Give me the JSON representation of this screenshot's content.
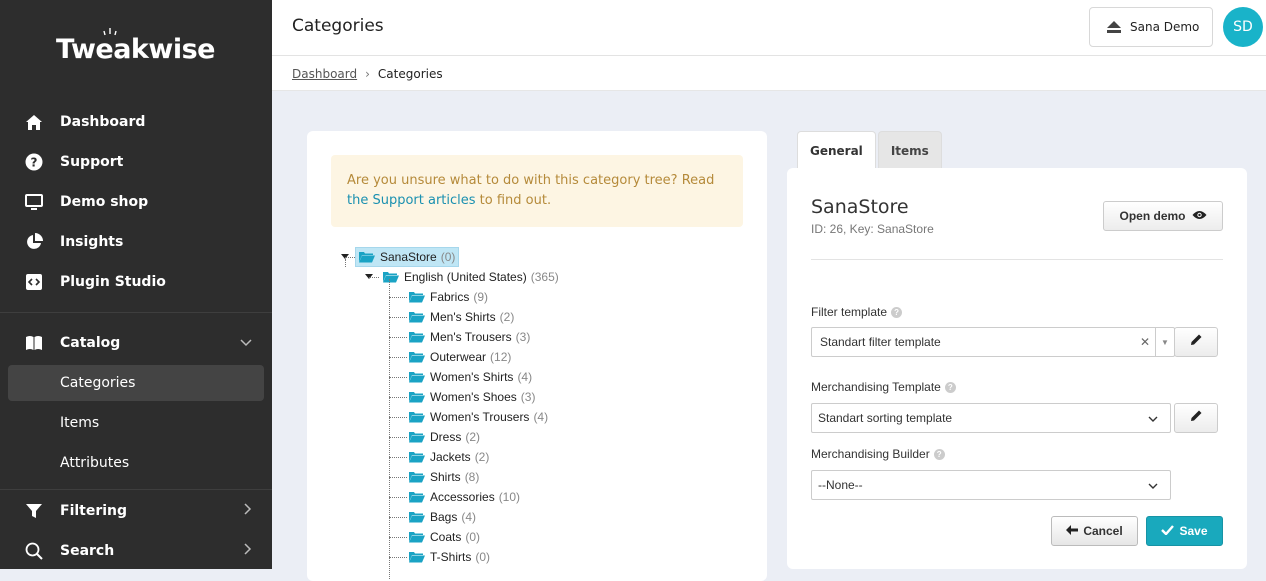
{
  "app": {
    "logo": "Tweakwise"
  },
  "sidebar": {
    "items": [
      {
        "label": "Dashboard",
        "icon": "home-icon"
      },
      {
        "label": "Support",
        "icon": "question-icon"
      },
      {
        "label": "Demo shop",
        "icon": "monitor-icon"
      },
      {
        "label": "Insights",
        "icon": "pie-chart-icon"
      },
      {
        "label": "Plugin Studio",
        "icon": "code-icon"
      },
      {
        "label": "Catalog",
        "icon": "book-icon"
      },
      {
        "label": "Filtering",
        "icon": "funnel-icon"
      },
      {
        "label": "Search",
        "icon": "search-icon"
      }
    ],
    "catalog_sub": [
      {
        "label": "Categories",
        "active": true
      },
      {
        "label": "Items",
        "active": false
      },
      {
        "label": "Attributes",
        "active": false
      }
    ]
  },
  "header": {
    "title": "Categories",
    "demo_label": "Sana Demo",
    "avatar_initials": "SD"
  },
  "breadcrumb": {
    "root": "Dashboard",
    "separator": "›",
    "current": "Categories"
  },
  "notice": {
    "text_before": "Are you unsure what to do with this category tree? Read ",
    "link": "the Support articles",
    "text_after": " to find out."
  },
  "tree": {
    "root": {
      "label": "SanaStore",
      "count": "(0)"
    },
    "child": {
      "label": "English (United States)",
      "count": "(365)"
    },
    "leaves": [
      {
        "label": "Fabrics",
        "count": "(9)"
      },
      {
        "label": "Men's Shirts",
        "count": "(2)"
      },
      {
        "label": "Men's Trousers",
        "count": "(3)"
      },
      {
        "label": "Outerwear",
        "count": "(12)"
      },
      {
        "label": "Women's Shirts",
        "count": "(4)"
      },
      {
        "label": "Women's Shoes",
        "count": "(3)"
      },
      {
        "label": "Women's Trousers",
        "count": "(4)"
      },
      {
        "label": "Dress",
        "count": "(2)"
      },
      {
        "label": "Jackets",
        "count": "(2)"
      },
      {
        "label": "Shirts",
        "count": "(8)"
      },
      {
        "label": "Accessories",
        "count": "(10)"
      },
      {
        "label": "Bags",
        "count": "(4)"
      },
      {
        "label": "Coats",
        "count": "(0)"
      },
      {
        "label": "T-Shirts",
        "count": "(0)"
      }
    ]
  },
  "tabs": [
    {
      "label": "General",
      "active": true
    },
    {
      "label": "Items",
      "active": false
    }
  ],
  "detail": {
    "name": "SanaStore",
    "id_line": "ID: 26, Key: SanaStore",
    "open_demo": "Open demo",
    "filter_template_label": "Filter template",
    "filter_template_value": "Standart filter template",
    "merch_template_label": "Merchandising Template",
    "merch_template_value": "Standart sorting template",
    "merch_builder_label": "Merchandising Builder",
    "merch_builder_value": "--None--",
    "cancel": "Cancel",
    "save": "Save"
  },
  "colors": {
    "accent": "#19a9bd",
    "sidebar_bg": "#2d2d2d",
    "folder": "#1aa3c4"
  }
}
